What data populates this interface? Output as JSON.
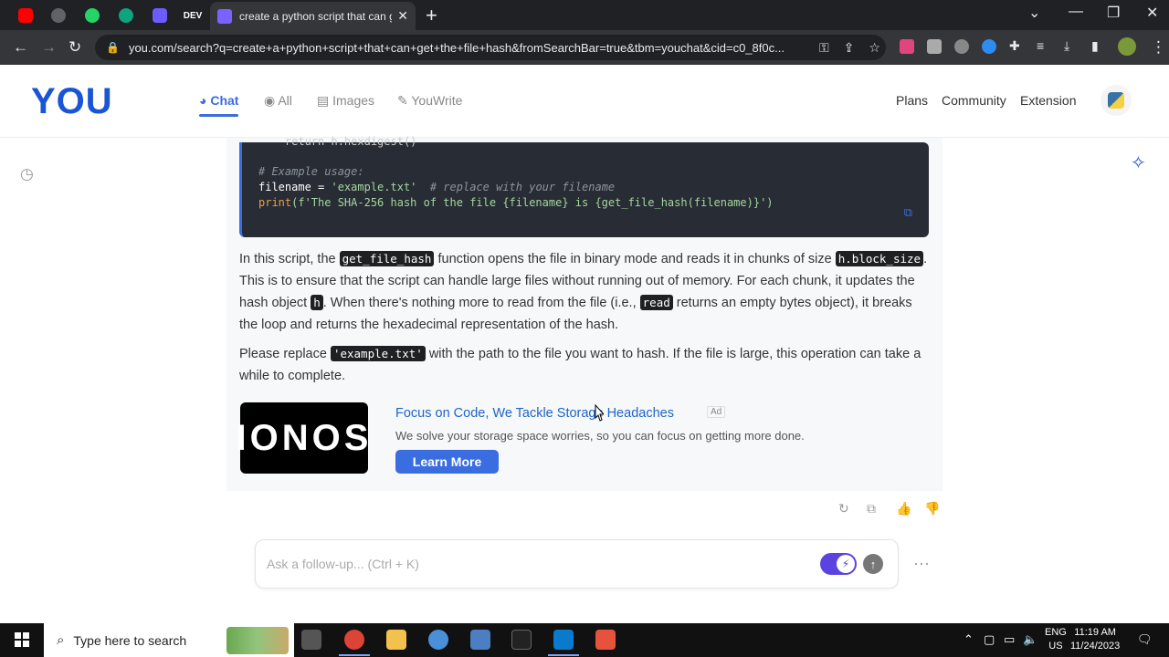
{
  "browser": {
    "active_tab_title": "create a python script that can g",
    "url": "you.com/search?q=create+a+python+script+that+can+get+the+file+hash&fromSearchBar=true&tbm=youchat&cid=c0_8f0c...",
    "pinned_tabs": [
      "youtube-icon",
      "chrome-icon",
      "whatsapp-icon",
      "chatgpt-icon",
      "shield-icon",
      "dev-icon"
    ],
    "pinned_dev_label": "DEV"
  },
  "header": {
    "logo": "YOU",
    "tabs": [
      {
        "label": "Chat",
        "icon": "chat-icon"
      },
      {
        "label": "All",
        "icon": "search-icon"
      },
      {
        "label": "Images",
        "icon": "image-icon"
      },
      {
        "label": "YouWrite",
        "icon": "pencil-icon"
      }
    ],
    "links": [
      "Plans",
      "Community",
      "Extension"
    ]
  },
  "code": {
    "line_partial": "    return h.hexdigest()",
    "comment": "# Example usage:",
    "assign_var": "filename = ",
    "assign_str": "'example.txt'",
    "assign_comment": "  # replace with your filename",
    "print_fn": "print",
    "print_str": "(f'The SHA-256 hash of the file {filename} is {get_file_hash(filename)}')"
  },
  "answer": {
    "p1_a": "In this script, the ",
    "p1_code1": "get_file_hash",
    "p1_b": " function opens the file in binary mode and reads it in chunks of size ",
    "p1_code2": "h.block_size",
    "p1_c": ". This is to ensure that the script can handle large files without running out of memory. For each chunk, it updates the hash object ",
    "p1_code3": "h",
    "p1_d": ". When there's nothing more to read from the file (i.e., ",
    "p1_code4": "read",
    "p1_e": " returns an empty bytes object), it breaks the loop and returns the hexadecimal representation of the hash.",
    "p2_a": "Please replace ",
    "p2_code": "'example.txt'",
    "p2_b": " with the path to the file you want to hash. If the file is large, this operation can take a while to complete."
  },
  "ad": {
    "logo_text": "IONOS",
    "title": "Focus on Code, We Tackle Storage Headaches",
    "badge": "Ad",
    "description": "We solve your storage space worries, so you can focus on getting more done.",
    "button": "Learn More"
  },
  "followup": {
    "placeholder": "Ask a follow-up... (Ctrl + K)"
  },
  "taskbar": {
    "search_placeholder": "Type here to search",
    "lang_top": "ENG",
    "lang_bottom": "US",
    "time": "11:19 AM",
    "date": "11/24/2023"
  }
}
